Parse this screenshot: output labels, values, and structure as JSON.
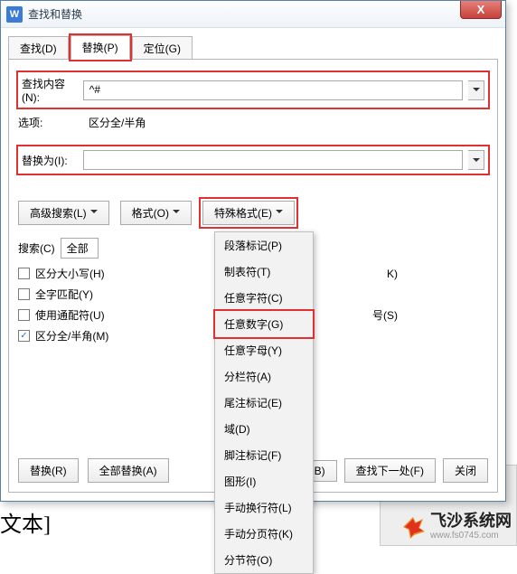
{
  "window": {
    "iconLetter": "W",
    "title": "查找和替换",
    "closeGlyph": "X"
  },
  "tabs": {
    "find": "查找(D)",
    "replace": "替换(P)",
    "goto": "定位(G)"
  },
  "fields": {
    "findLabel": "查找内容(N):",
    "findValue": "^#",
    "optionsLabel": "选项:",
    "optionsValue": "区分全/半角",
    "replaceLabel": "替换为(I):",
    "replaceValue": ""
  },
  "buttons": {
    "advanced": "高级搜索(L)",
    "format": "格式(O)",
    "special": "特殊格式(E)",
    "replace": "替换(R)",
    "replaceAll": "全部替换(A)",
    "findNext": "查找下一处(F)",
    "close": "关闭",
    "lastB": "B)"
  },
  "search": {
    "label": "搜索(C)",
    "value": "全部"
  },
  "checkboxes": {
    "matchCase": "区分大小写(H)",
    "wholeWord": "全字匹配(Y)",
    "wildcard": "使用通配符(U)",
    "fullHalf": "区分全/半角(M)",
    "matchK": "K)",
    "ignoreS": "号(S)"
  },
  "dropdown": {
    "items": [
      "段落标记(P)",
      "制表符(T)",
      "任意字符(C)",
      "任意数字(G)",
      "任意字母(Y)",
      "分栏符(A)",
      "尾注标记(E)",
      "域(D)",
      "脚注标记(F)",
      "图形(I)",
      "手动换行符(L)",
      "手动分页符(K)",
      "分节符(O)"
    ],
    "highlightIndex": 3
  },
  "background": {
    "docText": "文本]"
  },
  "brand": {
    "name": "飞沙系统网",
    "url": "www.fs0745.com"
  }
}
